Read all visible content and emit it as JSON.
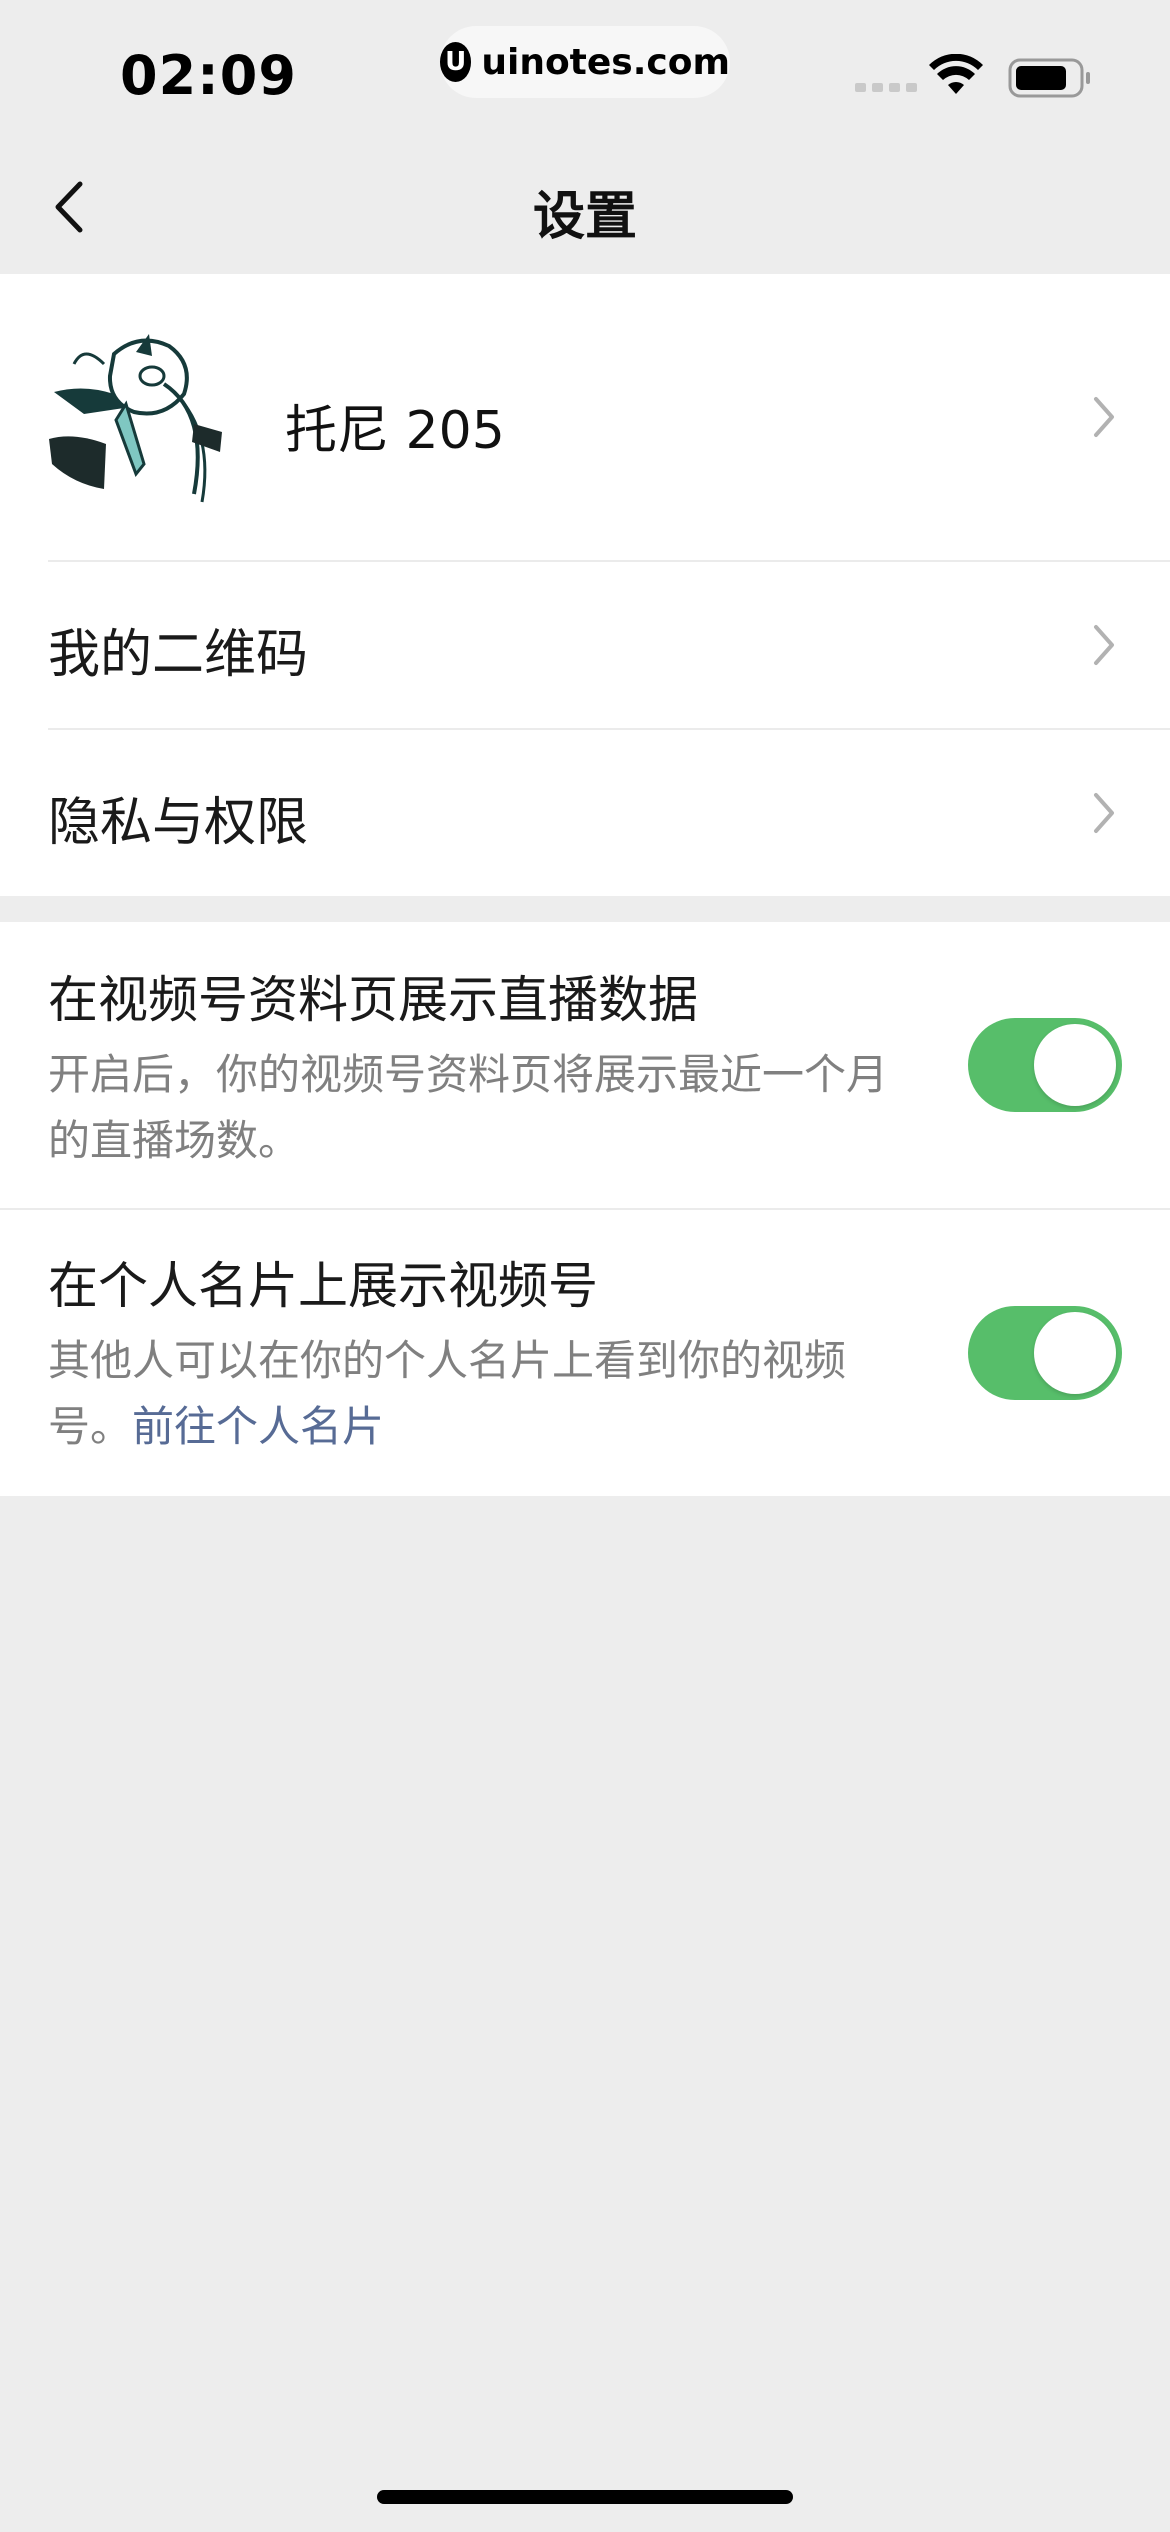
{
  "status_bar": {
    "time": "02:09",
    "site": "uinotes.com",
    "site_logo_letter": "U"
  },
  "nav": {
    "title": "设置",
    "back_icon": "chevron-left-icon"
  },
  "profile": {
    "name": "托尼 205",
    "avatar_icon": "anime-avatar"
  },
  "menu_items": [
    {
      "label": "我的二维码"
    },
    {
      "label": "隐私与权限"
    }
  ],
  "settings": [
    {
      "title": "在视频号资料页展示直播数据",
      "description": "开启后，你的视频号资料页将展示最近一个月的直播场数。",
      "enabled": true
    },
    {
      "title": "在个人名片上展示视频号",
      "description": "其他人可以在你的个人名片上看到你的视频号。",
      "link": "前往个人名片",
      "enabled": true
    }
  ],
  "colors": {
    "toggle_on": "#57be6a",
    "link": "#576b95",
    "background": "#ededed"
  }
}
